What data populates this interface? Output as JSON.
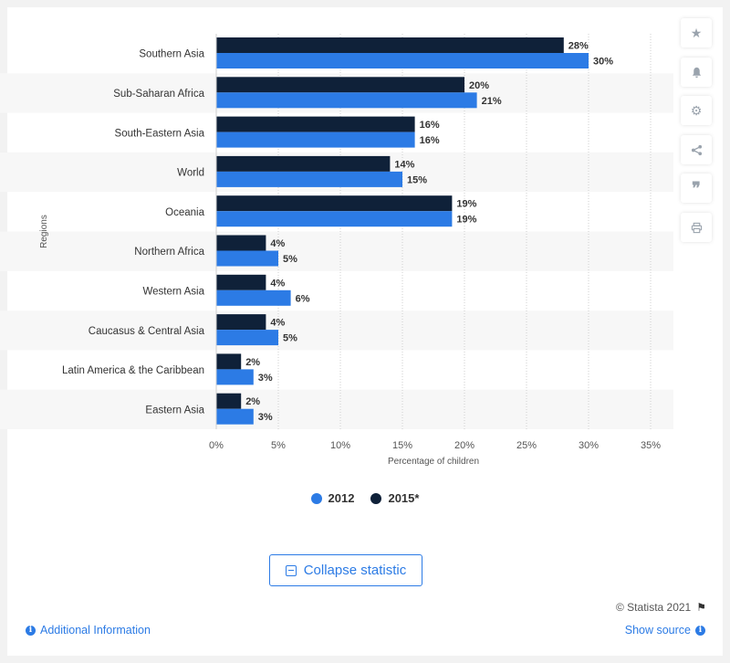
{
  "chart_data": {
    "type": "bar",
    "orientation": "horizontal",
    "categories": [
      "Southern Asia",
      "Sub-Saharan Africa",
      "South-Eastern Asia",
      "World",
      "Oceania",
      "Northern Africa",
      "Western Asia",
      "Caucasus & Central Asia",
      "Latin America & the Caribbean",
      "Eastern Asia"
    ],
    "series": [
      {
        "name": "2015*",
        "color": "#0f2139",
        "values": [
          28,
          20,
          16,
          14,
          19,
          4,
          4,
          4,
          2,
          2
        ],
        "labels": [
          "28%",
          "20%",
          "16%",
          "14%",
          "19%",
          "4%",
          "4%",
          "4%",
          "2%",
          "2%"
        ]
      },
      {
        "name": "2012",
        "color": "#2c7be5",
        "values": [
          30,
          21,
          16,
          15,
          19,
          5,
          6,
          5,
          3,
          3
        ],
        "labels": [
          "30%",
          "21%",
          "16%",
          "15%",
          "19%",
          "5%",
          "6%",
          "5%",
          "3%",
          "3%"
        ]
      }
    ],
    "xlabel": "Percentage of children",
    "ylabel": "Regions",
    "xlim": [
      0,
      35
    ],
    "xticks": [
      0,
      5,
      10,
      15,
      20,
      25,
      30,
      35
    ],
    "xtick_labels": [
      "0%",
      "5%",
      "10%",
      "15%",
      "20%",
      "25%",
      "30%",
      "35%"
    ],
    "grid": true,
    "legend": [
      "2012",
      "2015*"
    ]
  },
  "legend": {
    "items": [
      {
        "label": "2012",
        "color": "#2c7be5"
      },
      {
        "label": "2015*",
        "color": "#0f2139"
      }
    ]
  },
  "sidebar": {
    "icons": [
      "star-icon",
      "bell-icon",
      "gear-icon",
      "share-icon",
      "quote-icon",
      "print-icon"
    ]
  },
  "collapse": {
    "label": "Collapse statistic"
  },
  "footer": {
    "copyright": "© Statista 2021",
    "additional_info": "Additional Information",
    "show_source": "Show source"
  }
}
